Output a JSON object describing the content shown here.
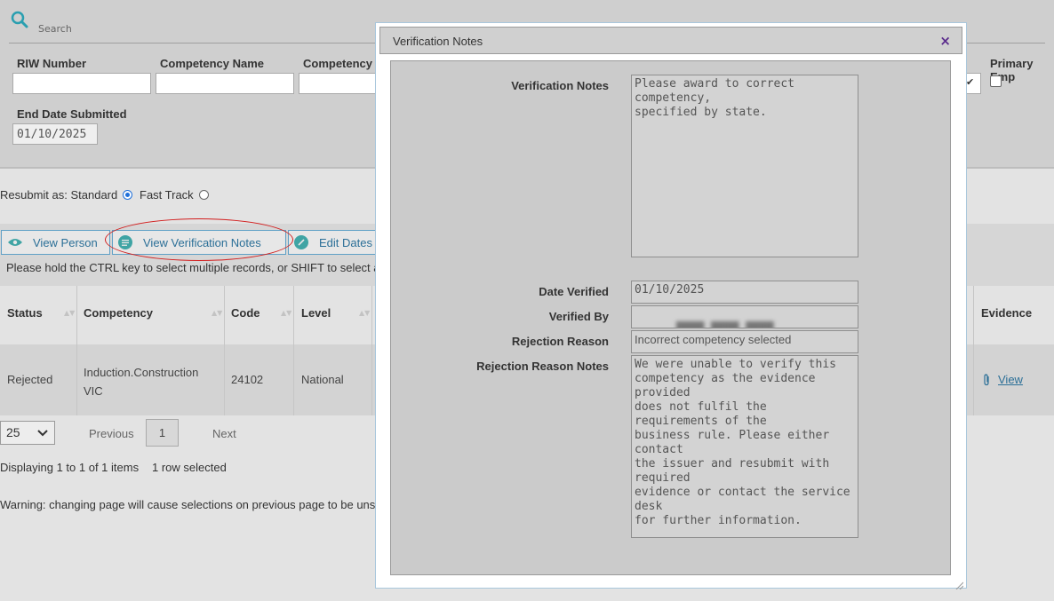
{
  "search": {
    "label": "Search",
    "fields": {
      "riw_number": "RIW Number",
      "competency_name": "Competency Name",
      "competency_code": "Competency C",
      "primary_employer": "Primary Emp",
      "end_date_submitted": "End Date Submitted"
    },
    "end_date_value": "01/10/2025"
  },
  "resubmit": {
    "label": "Resubmit as: Standard",
    "fast_track": "Fast Track",
    "selected": "Standard"
  },
  "toolbar": {
    "view_person": "View Person",
    "view_verification_notes": "View Verification Notes",
    "edit_dates": "Edit Dates"
  },
  "hint": "Please hold the CTRL key to select multiple records, or SHIFT to select a",
  "grid": {
    "columns": [
      "Status",
      "Competency",
      "Code",
      "Level",
      "Evidence"
    ],
    "rows": [
      {
        "status": "Rejected",
        "competency": "Induction.Construction VIC",
        "code": "24102",
        "level": "National",
        "evidence": "View"
      }
    ]
  },
  "pager": {
    "page_size": "25",
    "previous": "Previous",
    "current_page": "1",
    "next": "Next",
    "display": "Displaying 1 to 1 of 1 items",
    "selected": "1 row selected",
    "warning": "Warning: changing page will cause selections on previous page to be uns"
  },
  "modal": {
    "title": "Verification Notes",
    "close": "×",
    "labels": {
      "verification_notes": "Verification Notes",
      "date_verified": "Date Verified",
      "verified_by": "Verified By",
      "rejection_reason": "Rejection Reason",
      "rejection_reason_notes": "Rejection Reason Notes"
    },
    "values": {
      "verification_notes": "Please award to correct competency,\nspecified by state.",
      "date_verified": "01/10/2025",
      "verified_by": "████ ████ ████",
      "rejection_reason": "Incorrect competency selected",
      "rejection_reason_notes": "We were unable to verify this\ncompetency as the evidence provided\ndoes not fulfil the requirements of the\nbusiness rule. Please either contact\nthe issuer and resubmit with required\nevidence or contact the service desk\nfor further information."
    }
  },
  "colors": {
    "accent": "#2b6f97",
    "annotation": "#d21d1d",
    "close_icon": "#5a2b8c"
  }
}
